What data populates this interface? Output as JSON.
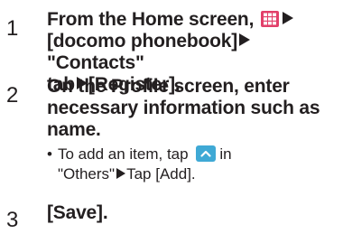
{
  "steps": [
    {
      "number": "1",
      "line1_prefix": "From the Home screen,",
      "apps_icon": "apps-grid-icon",
      "line2_text": "[docomo phonebook]",
      "tab_text": "\"Contacts\"",
      "line3_text": "tab",
      "register_text": "[Register]."
    },
    {
      "number": "2",
      "text_line1": "On the Profile screen, enter",
      "text_line2": "necessary information such as",
      "text_line3": "name.",
      "sub_bullet": "•",
      "sub_part1": "To add an item, tap",
      "sub_icon": "expand-up-icon",
      "sub_part2": "in",
      "sub_part3": "\"Others\"",
      "sub_part4": "Tap [Add]."
    },
    {
      "number": "3",
      "text": "[Save]."
    }
  ],
  "colors": {
    "text": "#231f20",
    "apps_icon_bg": "#e2406a",
    "up_icon_bg": "#3fa9d5"
  }
}
